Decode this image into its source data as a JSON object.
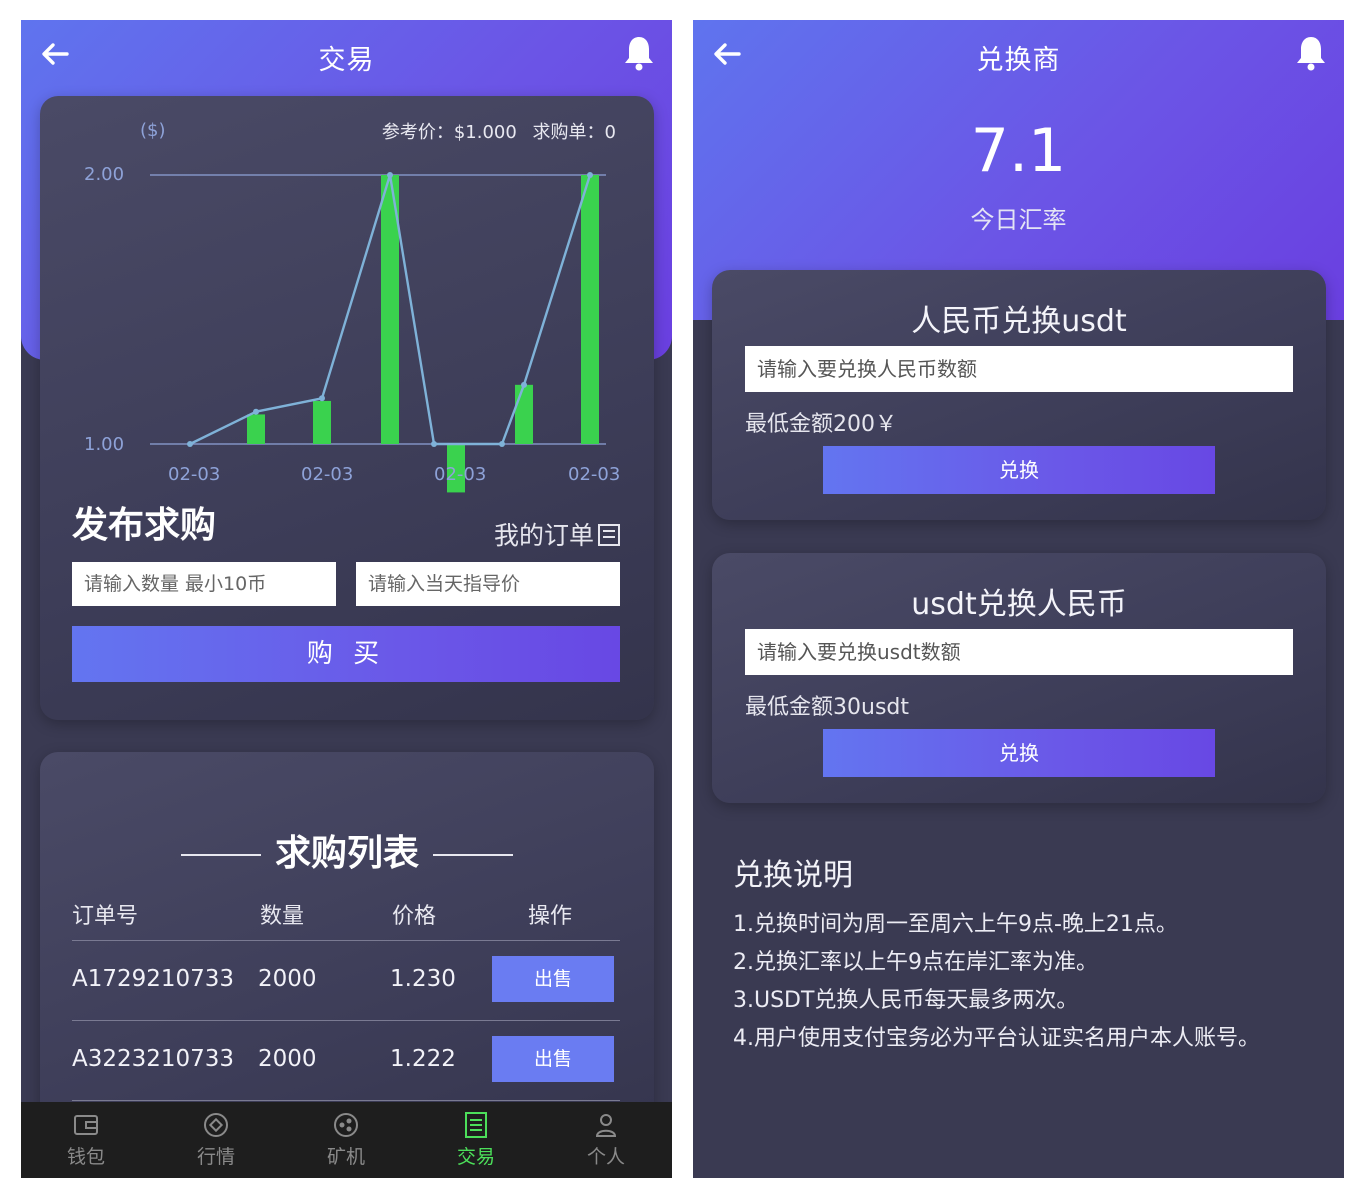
{
  "left_screen": {
    "header": {
      "title": "交易"
    },
    "chart_info": {
      "reference_price": "参考价：$1.000",
      "buy_orders": "求购单：0"
    },
    "chart_data": {
      "type": "bar",
      "unit_label": "($)",
      "x_tick_labels": [
        "02-03",
        "02-03",
        "02-03",
        "02-03"
      ],
      "y_tick_labels": [
        "2.00",
        "1.00"
      ],
      "ylim": [
        1.0,
        2.0
      ],
      "series": [
        {
          "type": "bar",
          "values": [
            1.11,
            1.16,
            2.0,
            0.82,
            1.22,
            2.0
          ]
        },
        {
          "type": "line",
          "values": [
            1.0,
            1.12,
            1.17,
            2.0,
            1.0,
            1.0,
            1.22,
            2.0
          ]
        }
      ],
      "colors": {
        "bar": "#3ad24e",
        "line": "#7fb2d8",
        "grid": "#8ea2d8"
      }
    },
    "publish": {
      "title": "发布求购",
      "my_orders": "我的订单",
      "quantity_placeholder": "请输入数量 最小10币",
      "price_placeholder": "请输入当天指导价",
      "buy_label": "购 买"
    },
    "order_list": {
      "title": "求购列表",
      "columns": [
        "订单号",
        "数量",
        "价格",
        "操作"
      ],
      "rows": [
        {
          "order_no": "A1729210733",
          "quantity": "2000",
          "price": "1.230",
          "action": "出售"
        },
        {
          "order_no": "A3223210733",
          "quantity": "2000",
          "price": "1.222",
          "action": "出售"
        }
      ]
    },
    "tabbar": [
      {
        "label": "钱包",
        "icon": "wallet-icon",
        "active": false
      },
      {
        "label": "行情",
        "icon": "market-icon",
        "active": false
      },
      {
        "label": "矿机",
        "icon": "miner-icon",
        "active": false
      },
      {
        "label": "交易",
        "icon": "trade-icon",
        "active": true
      },
      {
        "label": "个人",
        "icon": "user-icon",
        "active": false
      }
    ]
  },
  "right_screen": {
    "header": {
      "title": "兑换商"
    },
    "rate": {
      "value": "7.1",
      "label": "今日汇率"
    },
    "cny_to_usdt": {
      "title": "人民币兑换usdt",
      "placeholder": "请输入要兑换人民币数额",
      "min_amount": "最低金额200￥",
      "button": "兑换"
    },
    "usdt_to_cny": {
      "title": "usdt兑换人民币",
      "placeholder": "请输入要兑换usdt数额",
      "min_amount": "最低金额30usdt",
      "button": "兑换"
    },
    "notes": {
      "title": "兑换说明",
      "items": [
        "1.兑换时间为周一至周六上午9点-晚上21点。",
        "2.兑换汇率以上午9点在岸汇率为准。",
        "3.USDT兑换人民币每天最多两次。",
        "4.用户使用支付宝务必为平台认证实名用户本人账号。"
      ]
    }
  }
}
